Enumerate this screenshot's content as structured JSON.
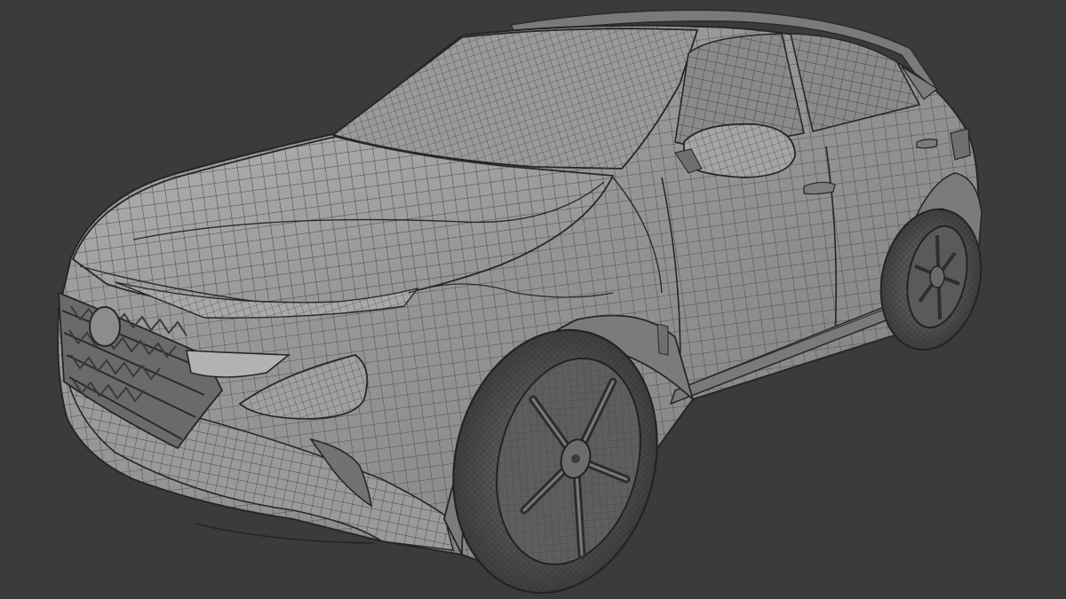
{
  "scene": {
    "subject": "wireframe-suv-3d-model",
    "colors": {
      "background": "#3b3b3b",
      "body_fill": "#8f8f8f",
      "body_light": "#a3a3a3",
      "body_dark": "#6c6c6c",
      "wire": "#2b2b2b",
      "tire": "#4a4a4a",
      "rim": "#5e5e5e"
    }
  }
}
